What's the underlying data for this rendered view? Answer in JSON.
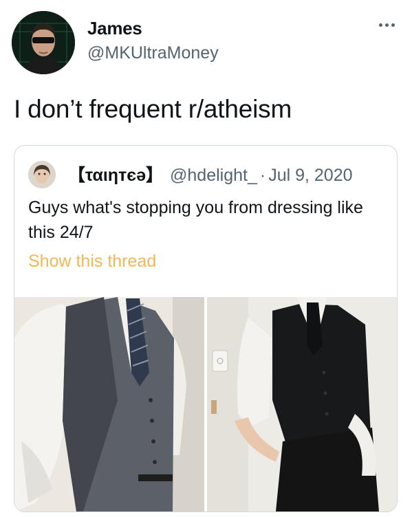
{
  "tweet": {
    "author": {
      "name": "James",
      "handle": "@MKUltraMoney",
      "avatar_icon": "user-avatar-sunglasses"
    },
    "text": "I don’t frequent r/atheism",
    "more_icon": "more-horizontal-icon",
    "quoted": {
      "name": "【ταιηтєә】",
      "handle": "@hdelight_",
      "separator": "·",
      "date": "Jul 9, 2020",
      "body": "Guys what's stopping you from dressing like this 24/7",
      "show_thread": "Show this thread",
      "photos": [
        "photo-grey-vest-mirror",
        "photo-black-vest-pose"
      ]
    }
  },
  "colors": {
    "text_primary": "#0f1419",
    "text_secondary": "#536471",
    "link_accent": "#f2b655",
    "card_border": "#cfd9de"
  }
}
